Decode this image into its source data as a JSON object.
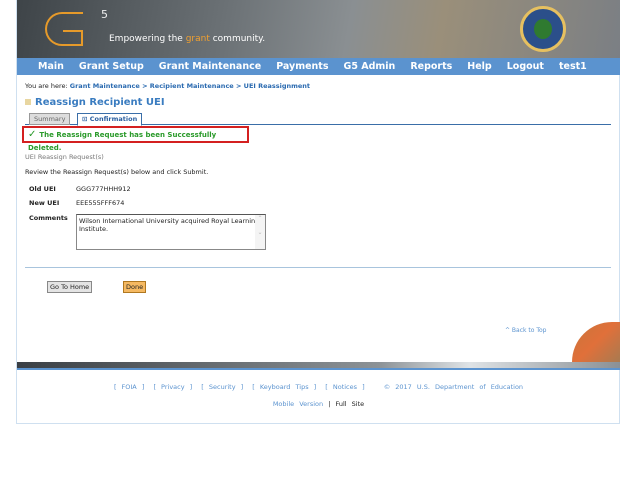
{
  "header": {
    "logo_text": "5",
    "tagline_pre": "Empowering the ",
    "tagline_accent": "grant",
    "tagline_post": " community."
  },
  "nav": [
    "Main",
    "Grant Setup",
    "Grant Maintenance",
    "Payments",
    "G5 Admin",
    "Reports",
    "Help",
    "Logout",
    "test1"
  ],
  "breadcrumb": {
    "prefix": "You are here: ",
    "path": "Grant Maintenance > Recipient Maintenance > UEI Reassignment"
  },
  "page_title": "Reassign Recipient UEI",
  "tabs": [
    {
      "label": "Summary"
    },
    {
      "label": "Confirmation",
      "active": true
    }
  ],
  "message": {
    "icon": "check-icon",
    "text": "The Reassign Request has been Successfully Deleted."
  },
  "section_title": "UEI Reassign Request(s)",
  "instructions": "Review the Reassign Request(s) below and click Submit.",
  "fields": {
    "old_uei_label": "Old UEI",
    "old_uei": "GGG777HHH912",
    "new_uei_label": "New UEI",
    "new_uei": "EEE555FFF674",
    "comments_label": "Comments",
    "comments": "Wilson International University acquired Royal Learning Institute."
  },
  "buttons": {
    "home": "Go To Home",
    "done": "Done"
  },
  "back_to_top": "^ Back to Top",
  "footer": {
    "links": [
      "[ FOIA ]",
      "[ Privacy ]",
      "[ Security ]",
      "[ Keyboard Tips ]",
      "[ Notices ]"
    ],
    "copyright": "© 2017 U.S. Department of Education",
    "mobile": "Mobile Version",
    "sep": "|",
    "full": "Full Site"
  },
  "colors": {
    "nav": "#5b93cf",
    "success": "#2a9a2a",
    "alert_border": "#d42020"
  }
}
